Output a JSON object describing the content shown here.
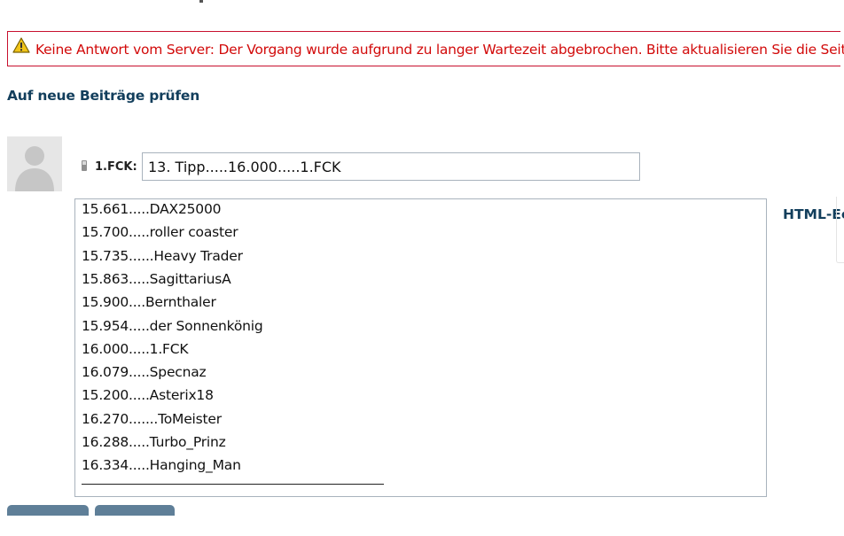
{
  "error": {
    "message": "Keine Antwort vom Server: Der Vorgang wurde aufgrund zu langer Wartezeit abgebrochen. Bitte aktualisieren Sie die Seite.",
    "icon": "warning-icon",
    "color": "#d20a0a"
  },
  "actions": {
    "check_new_posts": "Auf neue Beiträge prüfen",
    "html_editor": "HTML-Ec"
  },
  "post": {
    "user_label": "1.FCK:",
    "title_value": "13. Tipp.....16.000.....1.FCK",
    "message_lines": [
      "15.661.....DAX25000",
      "15.700.....roller coaster",
      "15.735......Heavy Trader",
      "15.863.....SagittariusA",
      "15.900....Bernthaler",
      "15.954.....der Sonnenkönig",
      "16.000.....1.FCK",
      "16.079.....Specnaz",
      "15.200.....Asterix18",
      "16.270.......ToMeister",
      "16.288.....Turbo_Prinz",
      "16.334.....Hanging_Man"
    ]
  },
  "colors": {
    "link": "#123e5c",
    "button": "#5f7f98",
    "border": "#a9b3bd"
  }
}
